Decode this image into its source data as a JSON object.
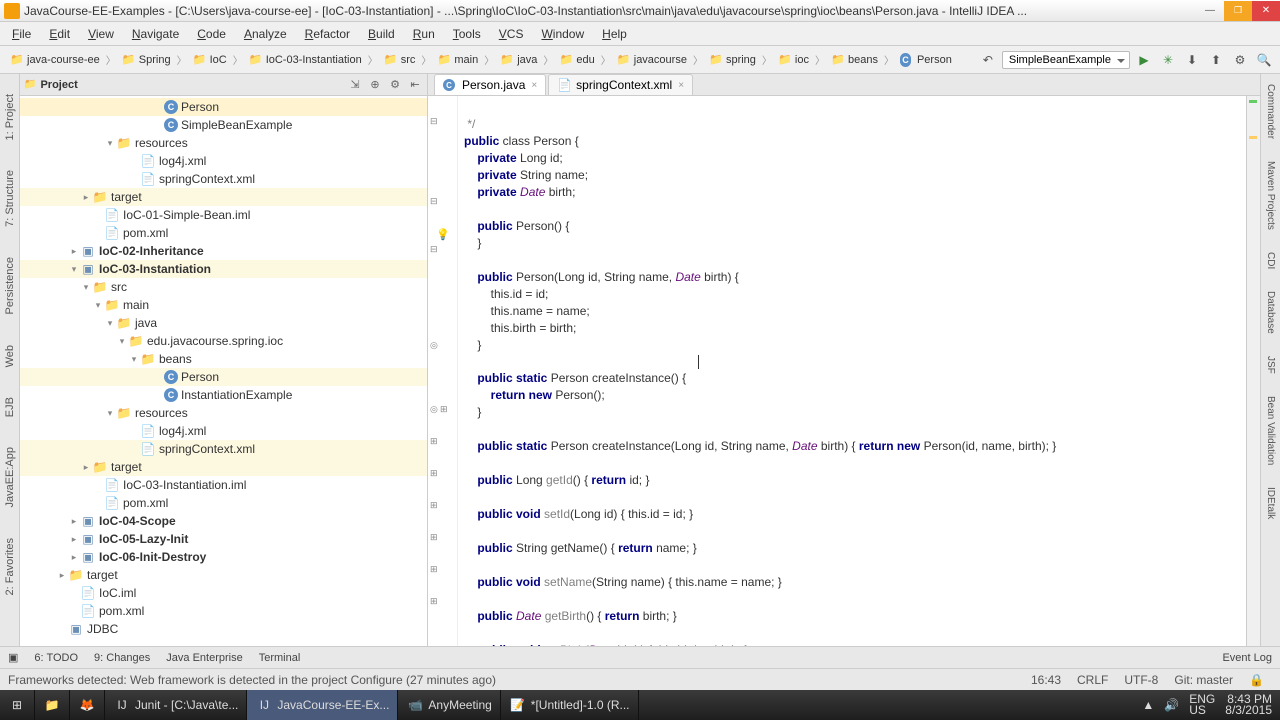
{
  "title": "JavaCourse-EE-Examples - [C:\\Users\\java-course-ee] - [IoC-03-Instantiation] - ...\\Spring\\IoC\\IoC-03-Instantiation\\src\\main\\java\\edu\\javacourse\\spring\\ioc\\beans\\Person.java - IntelliJ IDEA ...",
  "menu": [
    "File",
    "Edit",
    "View",
    "Navigate",
    "Code",
    "Analyze",
    "Refactor",
    "Build",
    "Run",
    "Tools",
    "VCS",
    "Window",
    "Help"
  ],
  "crumbs": [
    "java-course-ee",
    "Spring",
    "IoC",
    "IoC-03-Instantiation",
    "src",
    "main",
    "java",
    "edu",
    "javacourse",
    "spring",
    "ioc",
    "beans",
    "Person"
  ],
  "run_config": "SimpleBeanExample",
  "project_label": "Project",
  "tree": [
    {
      "indent": 11,
      "twisty": "",
      "icon": "class",
      "label": "Person",
      "sel": true
    },
    {
      "indent": 11,
      "twisty": "",
      "icon": "class",
      "label": "SimpleBeanExample"
    },
    {
      "indent": 7,
      "twisty": "▾",
      "icon": "folder",
      "label": "resources"
    },
    {
      "indent": 9,
      "twisty": "",
      "icon": "xml",
      "label": "log4j.xml"
    },
    {
      "indent": 9,
      "twisty": "",
      "icon": "xml",
      "label": "springContext.xml"
    },
    {
      "indent": 5,
      "twisty": "▸",
      "icon": "folder",
      "label": "target",
      "hl": true
    },
    {
      "indent": 6,
      "twisty": "",
      "icon": "iml",
      "label": "IoC-01-Simple-Bean.iml"
    },
    {
      "indent": 6,
      "twisty": "",
      "icon": "iml",
      "label": "pom.xml"
    },
    {
      "indent": 4,
      "twisty": "▸",
      "icon": "module",
      "label": "IoC-02-Inheritance",
      "bold": true
    },
    {
      "indent": 4,
      "twisty": "▾",
      "icon": "module",
      "label": "IoC-03-Instantiation",
      "bold": true,
      "hl": true
    },
    {
      "indent": 5,
      "twisty": "▾",
      "icon": "folder",
      "label": "src"
    },
    {
      "indent": 6,
      "twisty": "▾",
      "icon": "folder",
      "label": "main"
    },
    {
      "indent": 7,
      "twisty": "▾",
      "icon": "folder",
      "label": "java"
    },
    {
      "indent": 8,
      "twisty": "▾",
      "icon": "folder",
      "label": "edu.javacourse.spring.ioc"
    },
    {
      "indent": 9,
      "twisty": "▾",
      "icon": "folder",
      "label": "beans"
    },
    {
      "indent": 11,
      "twisty": "",
      "icon": "class",
      "label": "Person",
      "sel": true,
      "hl": true
    },
    {
      "indent": 11,
      "twisty": "",
      "icon": "class",
      "label": "InstantiationExample"
    },
    {
      "indent": 7,
      "twisty": "▾",
      "icon": "folder",
      "label": "resources"
    },
    {
      "indent": 9,
      "twisty": "",
      "icon": "xml",
      "label": "log4j.xml"
    },
    {
      "indent": 9,
      "twisty": "",
      "icon": "xml",
      "label": "springContext.xml",
      "hl": true
    },
    {
      "indent": 5,
      "twisty": "▸",
      "icon": "folder",
      "label": "target",
      "hl": true
    },
    {
      "indent": 6,
      "twisty": "",
      "icon": "iml",
      "label": "IoC-03-Instantiation.iml"
    },
    {
      "indent": 6,
      "twisty": "",
      "icon": "iml",
      "label": "pom.xml"
    },
    {
      "indent": 4,
      "twisty": "▸",
      "icon": "module",
      "label": "IoC-04-Scope",
      "bold": true
    },
    {
      "indent": 4,
      "twisty": "▸",
      "icon": "module",
      "label": "IoC-05-Lazy-Init",
      "bold": true
    },
    {
      "indent": 4,
      "twisty": "▸",
      "icon": "module",
      "label": "IoC-06-Init-Destroy",
      "bold": true
    },
    {
      "indent": 3,
      "twisty": "▸",
      "icon": "folder",
      "label": "target"
    },
    {
      "indent": 4,
      "twisty": "",
      "icon": "iml",
      "label": "IoC.iml"
    },
    {
      "indent": 4,
      "twisty": "",
      "icon": "iml",
      "label": "pom.xml"
    },
    {
      "indent": 3,
      "twisty": "",
      "icon": "module",
      "label": "JDBC"
    }
  ],
  "tabs": [
    {
      "icon": "class",
      "label": "Person.java",
      "active": true
    },
    {
      "icon": "xml",
      "label": "springContext.xml"
    }
  ],
  "side_left": [
    "1: Project",
    "7: Structure"
  ],
  "side_left2": [
    "Persistence",
    "Web",
    "EJB",
    "JavaEE:App",
    "2: Favorites"
  ],
  "side_right": [
    "Commander",
    "Maven Projects",
    "CDI",
    "Database",
    "JSF",
    "Bean Validation",
    "IDEtalk"
  ],
  "bottom": [
    "6: TODO",
    "9: Changes",
    "Java Enterprise",
    "Terminal"
  ],
  "event_log": "Event Log",
  "status_msg": "Frameworks detected: Web framework is detected in the project Configure (27 minutes ago)",
  "status_right": {
    "time": "16:43",
    "sep": "CRLF",
    "enc": "UTF-8",
    "git": "Git: master"
  },
  "taskbar": [
    {
      "icon": "win",
      "label": ""
    },
    {
      "icon": "files",
      "label": ""
    },
    {
      "icon": "ff",
      "label": ""
    },
    {
      "icon": "ij",
      "label": "Junit - [C:\\Java\\te..."
    },
    {
      "icon": "ij",
      "label": "JavaCourse-EE-Ex...",
      "active": true
    },
    {
      "icon": "any",
      "label": "AnyMeeting"
    },
    {
      "icon": "np",
      "label": "*[Untitled]-1.0 (R..."
    }
  ],
  "tray": {
    "lang": "ENG\nUS",
    "time": "8:43 PM",
    "date": "8/3/2015"
  },
  "code": {
    "l1": " */",
    "l2a": "public",
    "l2b": " class ",
    "l2c": "Person {",
    "l3a": "    private ",
    "l3b": "Long id;",
    "l4a": "    private ",
    "l4b": "String name;",
    "l5a": "    private ",
    "l5b": "Date",
    "l5c": " birth;",
    "l6": "",
    "l7a": "    public ",
    "l7b": "Person() {",
    "l8": "    }",
    "l9": "",
    "l10a": "    public ",
    "l10b": "Person(Long id, String name, ",
    "l10c": "Date",
    "l10d": " birth) {",
    "l11": "        this.id = id;",
    "l12": "        this.name = name;",
    "l13": "        this.birth = birth;",
    "l14": "    }",
    "l15": "",
    "l16a": "    public static ",
    "l16b": "Person createInstance() {",
    "l17a": "        return new ",
    "l17b": "Person();",
    "l18": "    }",
    "l19": "",
    "l20a": "    public static ",
    "l20b": "Person createInstance(Long id, String name, ",
    "l20c": "Date",
    "l20d": " birth) { ",
    "l20e": "return new ",
    "l20f": "Person(id, name, birth); }",
    "l21": "",
    "l22a": "    public ",
    "l22b": "Long ",
    "l22c": "getId",
    "l22d": "() { ",
    "l22e": "return ",
    "l22f": "id; }",
    "l23": "",
    "l24a": "    public void ",
    "l24b": "setId",
    "l24c": "(Long id) { ",
    "l24d": "this.id = id; }",
    "l25": "",
    "l26a": "    public ",
    "l26b": "String getName() { ",
    "l26c": "return ",
    "l26d": "name; }",
    "l27": "",
    "l28a": "    public void ",
    "l28b": "setName",
    "l28c": "(String name) { ",
    "l28d": "this.name = name; }",
    "l29": "",
    "l30a": "    public ",
    "l30b": "Date",
    "l30c": " ",
    "l30d": "getBirth",
    "l30e": "() { ",
    "l30f": "return ",
    "l30g": "birth; }",
    "l31": "",
    "l32a": "    public void ",
    "l32b": "setBirth",
    "l32c": "(",
    "l32d": "Date",
    "l32e": " birth) { ",
    "l32f": "this.birth = birth; }",
    "l33": "}"
  }
}
